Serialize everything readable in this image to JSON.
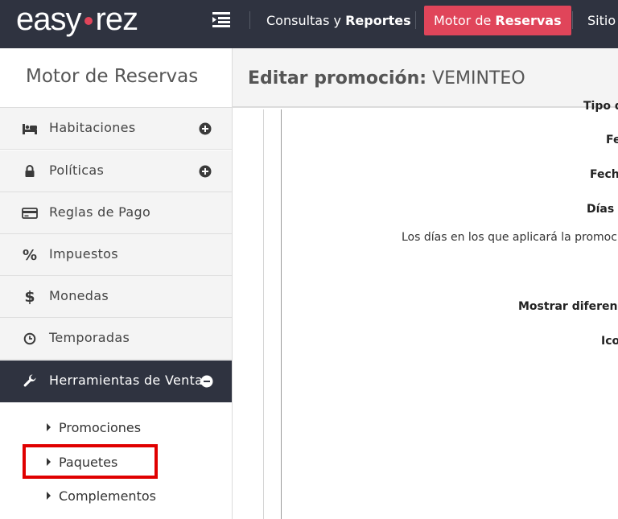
{
  "topbar": {
    "logo_left": "easy",
    "logo_right": "rez",
    "nav": [
      {
        "prefix": "Consultas y ",
        "bold": "Reportes"
      },
      {
        "prefix": "Motor de ",
        "bold": "Reservas"
      },
      {
        "prefix": "Sitio",
        "bold": ""
      }
    ]
  },
  "sidebar": {
    "title": "Motor de Reservas",
    "items": [
      {
        "label": "Habitaciones"
      },
      {
        "label": "Políticas"
      },
      {
        "label": "Reglas de Pago"
      },
      {
        "label": "Impuestos"
      },
      {
        "label": "Monedas"
      },
      {
        "label": "Temporadas"
      },
      {
        "label": "Herramientas de Venta"
      }
    ],
    "subitems": [
      {
        "label": "Promociones"
      },
      {
        "label": "Paquetes"
      },
      {
        "label": "Complementos"
      }
    ]
  },
  "content": {
    "title_bold": "Editar promoción:",
    "title_value": "VEMINTEO",
    "fields": [
      "Tipo d",
      "Fe",
      "Fech",
      "Días d",
      "Mostrar diferenc",
      "Ico"
    ],
    "help_text": "Los días en los que aplicará la promoci"
  },
  "colors": {
    "topbar_bg": "#2f3340",
    "accent": "#e0455a",
    "highlight": "#e00000"
  }
}
